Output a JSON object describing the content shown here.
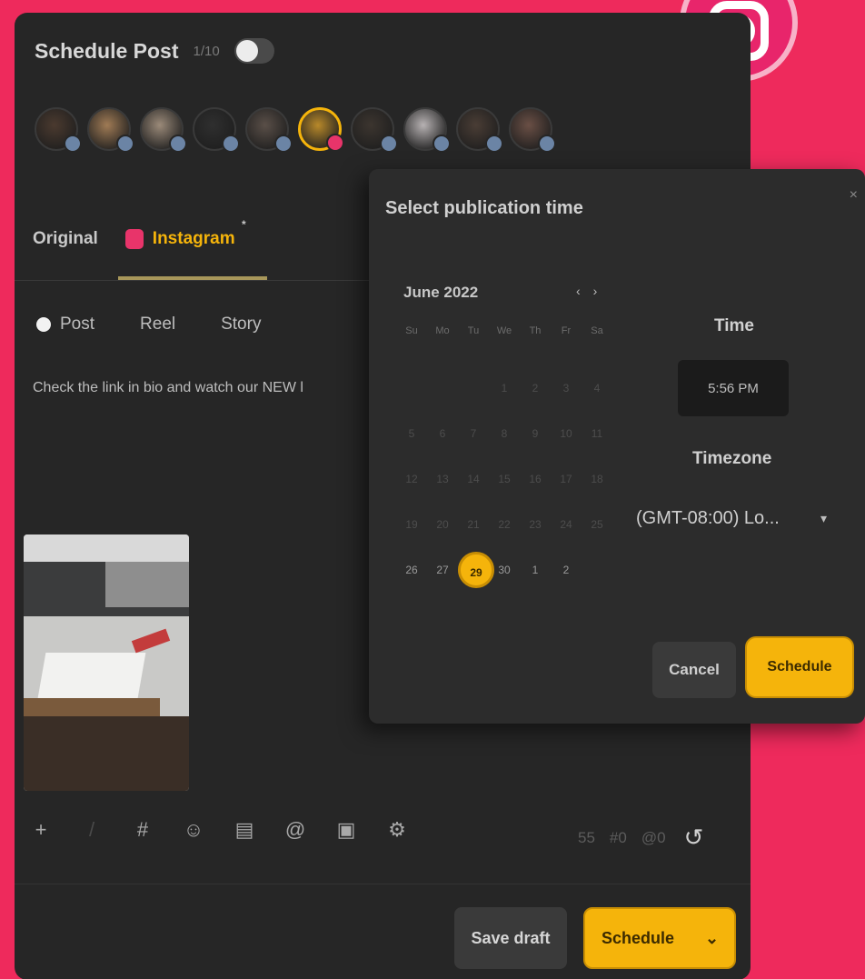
{
  "header": {
    "title": "Schedule Post",
    "count": "1/10"
  },
  "avatars": {
    "count": 10,
    "selected_index": 5,
    "colors": [
      "#4b3a2f",
      "#a07b55",
      "#9b8a79",
      "#2f2f2f",
      "#5a4f48",
      "#b8892a",
      "#3c352f",
      "#b7b2b3",
      "#4a3d35",
      "#6a4f45"
    ]
  },
  "tabs": {
    "original": "Original",
    "instagram": "Instagram",
    "modified_marker": "*"
  },
  "post_types": [
    "Post",
    "Reel",
    "Story"
  ],
  "caption": "Check the link in bio and watch our NEW l",
  "toolbar": {
    "icons": [
      "plus-icon",
      "magic-wand-icon",
      "hashtag-icon",
      "emoji-icon",
      "document-icon",
      "at-icon",
      "image-icon",
      "settings-icon"
    ],
    "counts": [
      "55",
      "#0",
      "@0"
    ]
  },
  "footer": {
    "save_draft": "Save draft",
    "schedule": "Schedule",
    "caret": "⌄"
  },
  "popover": {
    "title": "Select publication time",
    "close": "×",
    "calendar": {
      "month": "June 2022",
      "weekdays": [
        "Su",
        "Mo",
        "Tu",
        "We",
        "Th",
        "Fr",
        "Sa"
      ],
      "weeks": [
        [
          "",
          "",
          "",
          "1",
          "2",
          "3",
          "4"
        ],
        [
          "5",
          "6",
          "7",
          "8",
          "9",
          "10",
          "11"
        ],
        [
          "12",
          "13",
          "14",
          "15",
          "16",
          "17",
          "18"
        ],
        [
          "19",
          "20",
          "21",
          "22",
          "23",
          "24",
          "25"
        ],
        [
          "26",
          "27",
          "29",
          "30",
          "1",
          "2",
          ""
        ]
      ],
      "today": "29"
    },
    "time_label": "Time",
    "time_value": "5:56 PM",
    "timezone_label": "Timezone",
    "timezone_value": "(GMT-08:00) Lo...",
    "cancel": "Cancel",
    "schedule": "Schedule"
  },
  "colors": {
    "accent": "#f5b40b",
    "background": "#ee2a5c",
    "panel": "#262626",
    "instagram": "#e8346a"
  }
}
